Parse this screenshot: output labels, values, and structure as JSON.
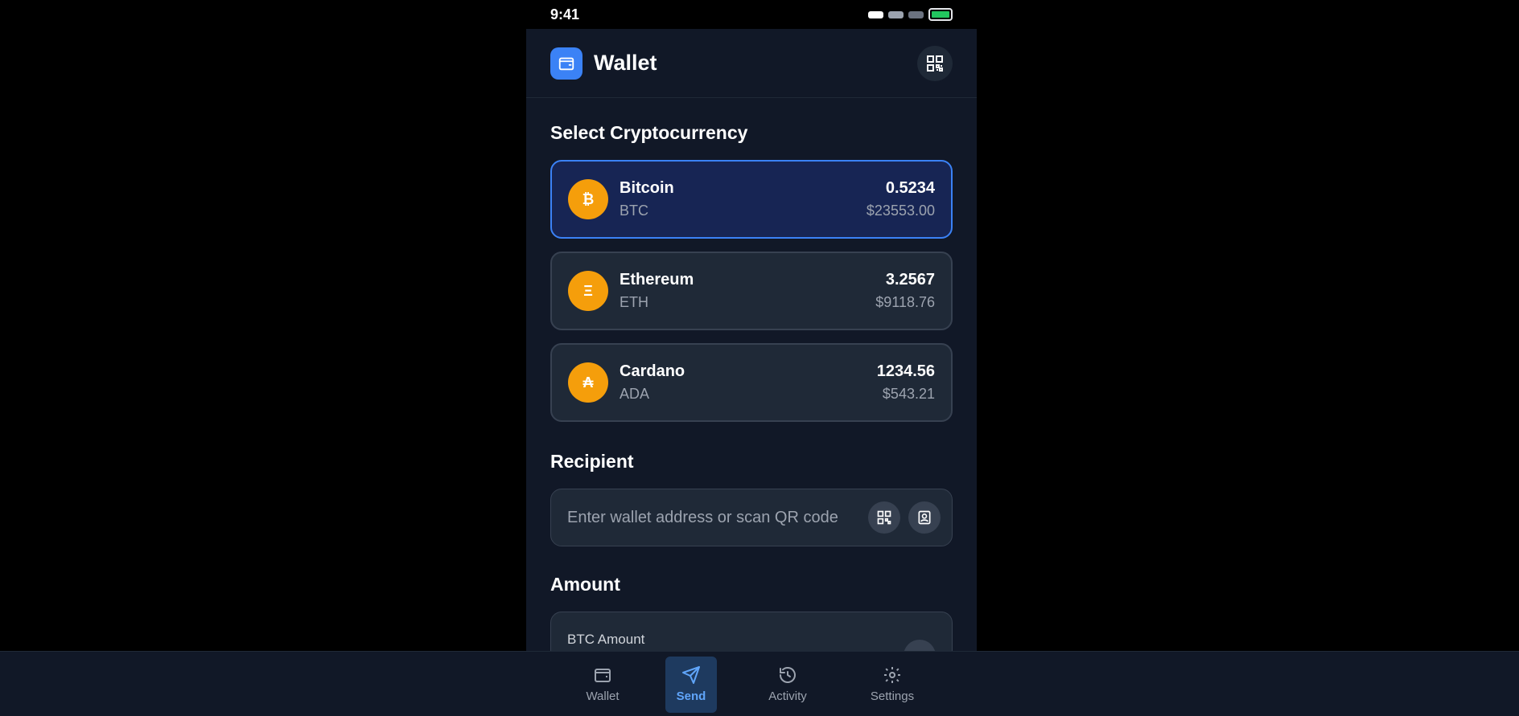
{
  "status_bar": {
    "time": "9:41"
  },
  "header": {
    "title": "Wallet",
    "logo_icon": "wallet-icon",
    "action_icon": "qr-code-icon"
  },
  "select_section": {
    "title": "Select Cryptocurrency"
  },
  "cryptos": [
    {
      "name": "Bitcoin",
      "symbol": "BTC",
      "glyph": "₿",
      "balance": "0.5234",
      "fiat": "$23553.00",
      "selected": true
    },
    {
      "name": "Ethereum",
      "symbol": "ETH",
      "glyph": "Ξ",
      "balance": "3.2567",
      "fiat": "$9118.76",
      "selected": false
    },
    {
      "name": "Cardano",
      "symbol": "ADA",
      "glyph": "₳",
      "balance": "1234.56",
      "fiat": "$543.21",
      "selected": false
    }
  ],
  "recipient": {
    "title": "Recipient",
    "placeholder": "Enter wallet address or scan QR code",
    "value": ""
  },
  "amount": {
    "title": "Amount",
    "label": "BTC Amount"
  },
  "nav": {
    "items": [
      {
        "label": "Wallet",
        "icon": "wallet-icon",
        "active": false
      },
      {
        "label": "Send",
        "icon": "send-icon",
        "active": true
      },
      {
        "label": "Activity",
        "icon": "history-icon",
        "active": false
      },
      {
        "label": "Settings",
        "icon": "gear-icon",
        "active": false
      }
    ]
  },
  "colors": {
    "accent": "#3b82f6",
    "coin": "#f59e0b",
    "background": "#111827",
    "card": "#1f2937",
    "battery": "#22c55e"
  }
}
